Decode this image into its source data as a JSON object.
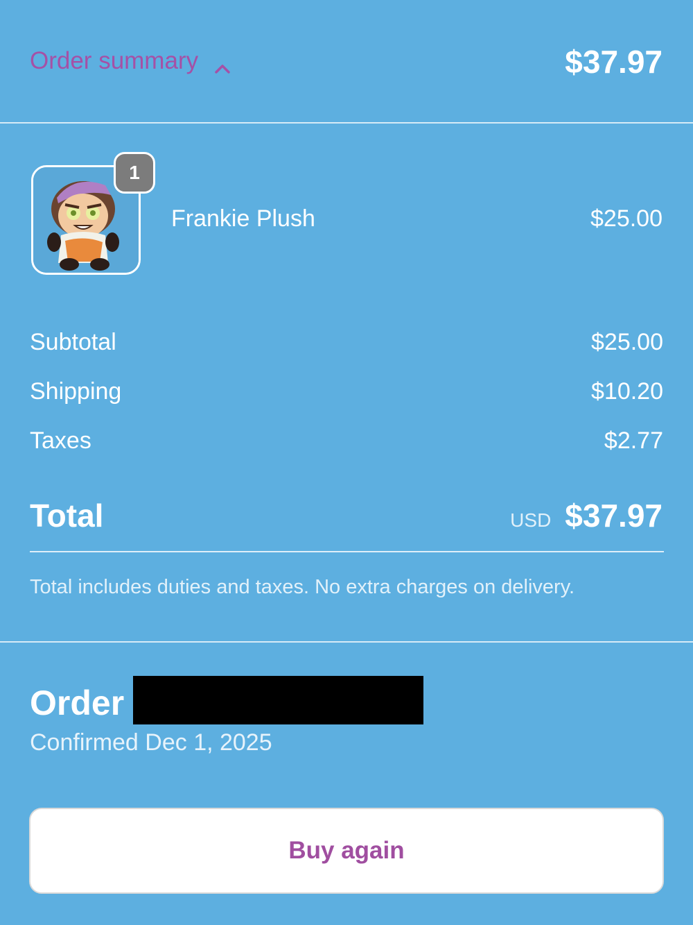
{
  "header": {
    "summary_toggle_label": "Order summary",
    "total": "$37.97"
  },
  "line_items": [
    {
      "name": "Frankie Plush",
      "price": "$25.00",
      "quantity": "1",
      "image_icon": "plush-toy-photo"
    }
  ],
  "totals": {
    "subtotal_label": "Subtotal",
    "subtotal_value": "$25.00",
    "shipping_label": "Shipping",
    "shipping_value": "$10.20",
    "taxes_label": "Taxes",
    "taxes_value": "$2.77",
    "total_label": "Total",
    "currency": "USD",
    "total_value": "$37.97",
    "note": "Total includes duties and taxes. No extra charges on delivery."
  },
  "order": {
    "title": "Order",
    "confirmed": "Confirmed Dec 1, 2025"
  },
  "actions": {
    "buy_again_label": "Buy again"
  },
  "colors": {
    "background": "#5dafe0",
    "accent": "#a551a6",
    "badge": "#7c7c7c"
  }
}
